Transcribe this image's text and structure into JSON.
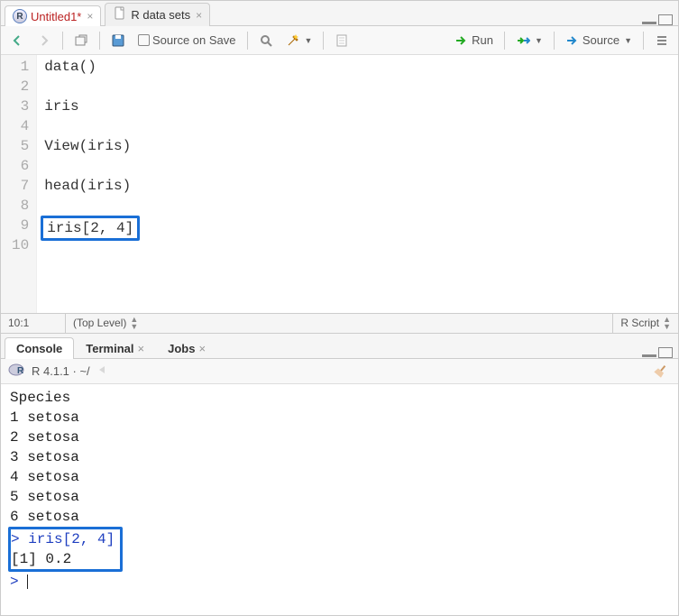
{
  "source": {
    "tabs": [
      {
        "label": "Untitled1*",
        "dirty": true,
        "icon": "r-file"
      },
      {
        "label": "R data sets",
        "dirty": false,
        "icon": "doc"
      }
    ],
    "toolbar": {
      "source_on_save": "Source on Save",
      "run": "Run",
      "source_btn": "Source"
    },
    "lines": [
      "data()",
      "",
      "iris",
      "",
      "View(iris)",
      "",
      "head(iris)",
      "",
      "iris[2, 4]",
      ""
    ],
    "highlight_line_index": 8,
    "status": {
      "cursor": "10:1",
      "scope": "(Top Level)",
      "filetype": "R Script"
    }
  },
  "console": {
    "tabs": [
      {
        "label": "Console",
        "active": true,
        "closable": false
      },
      {
        "label": "Terminal",
        "active": false,
        "closable": true
      },
      {
        "label": "Jobs",
        "active": false,
        "closable": true
      }
    ],
    "header": "R 4.1.1 · ~/",
    "output": [
      {
        "t": "out",
        "text": "  Species"
      },
      {
        "t": "out",
        "text": "1  setosa"
      },
      {
        "t": "out",
        "text": "2  setosa"
      },
      {
        "t": "out",
        "text": "3  setosa"
      },
      {
        "t": "out",
        "text": "4  setosa"
      },
      {
        "t": "out",
        "text": "5  setosa"
      },
      {
        "t": "out",
        "text": "6  setosa"
      },
      {
        "t": "prompt",
        "text": "> iris[2, 4]"
      },
      {
        "t": "out",
        "text": "[1] 0.2"
      },
      {
        "t": "prompt",
        "text": "> "
      }
    ],
    "highlight_start": 7,
    "highlight_end": 8
  }
}
